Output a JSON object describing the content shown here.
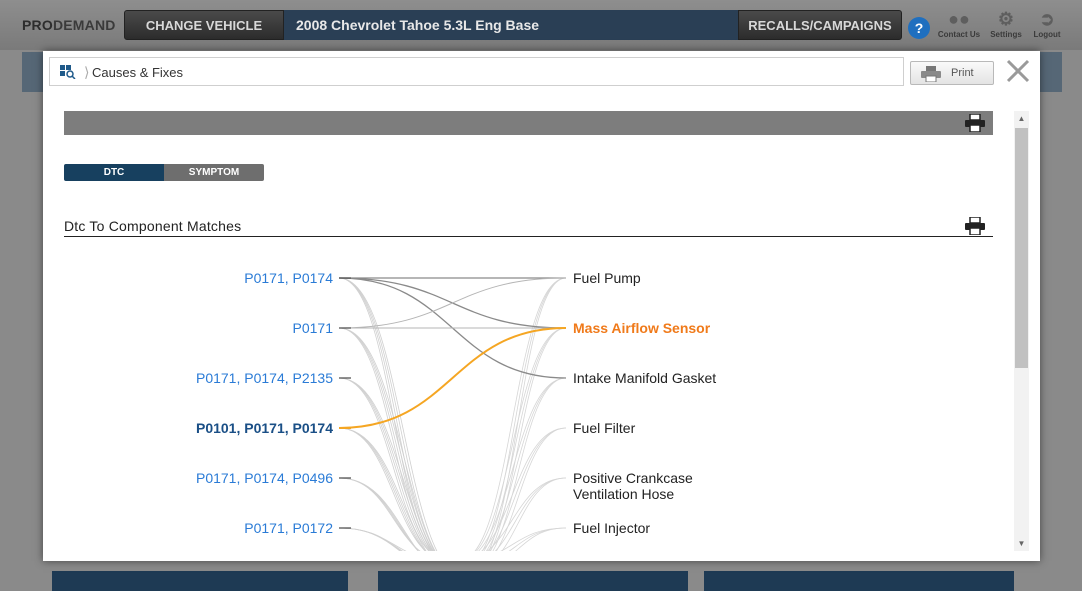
{
  "app": {
    "brand_pro": "PRO",
    "brand_demand": "DEMAND",
    "change_vehicle": "CHANGE VEHICLE",
    "vehicle": "2008 Chevrolet Tahoe 5.3L Eng Base",
    "recalls": "RECALLS/CAMPAIGNS",
    "help": "?",
    "contact": "Contact Us",
    "settings": "Settings",
    "logout": "Logout"
  },
  "modal": {
    "breadcrumb": "Causes & Fixes",
    "print_label": "Print",
    "tabs": {
      "dtc": "DTC",
      "symptom": "SYMPTOM"
    },
    "section_title": "Dtc To Component Matches"
  },
  "matches": {
    "dtcs": [
      {
        "label": "P0171, P0174",
        "selected": false
      },
      {
        "label": "P0171",
        "selected": false
      },
      {
        "label": "P0171, P0174, P2135",
        "selected": false
      },
      {
        "label": "P0101, P0171, P0174",
        "selected": true
      },
      {
        "label": "P0171, P0174, P0496",
        "selected": false
      },
      {
        "label": "P0171, P0172",
        "selected": false
      }
    ],
    "components": [
      {
        "lines": [
          "Fuel Pump"
        ],
        "highlighted": false
      },
      {
        "lines": [
          "Mass Airflow Sensor"
        ],
        "highlighted": true
      },
      {
        "lines": [
          "Intake Manifold Gasket"
        ],
        "highlighted": false
      },
      {
        "lines": [
          "Fuel Filter"
        ],
        "highlighted": false
      },
      {
        "lines": [
          "Positive Crankcase",
          "Ventilation Hose"
        ],
        "highlighted": false
      },
      {
        "lines": [
          "Fuel Injector"
        ],
        "highlighted": false
      }
    ]
  },
  "colors": {
    "accent": "#f5a623",
    "highlight_text": "#f07a1a",
    "link": "#2a7bd6",
    "nav_dark": "#17405f"
  }
}
